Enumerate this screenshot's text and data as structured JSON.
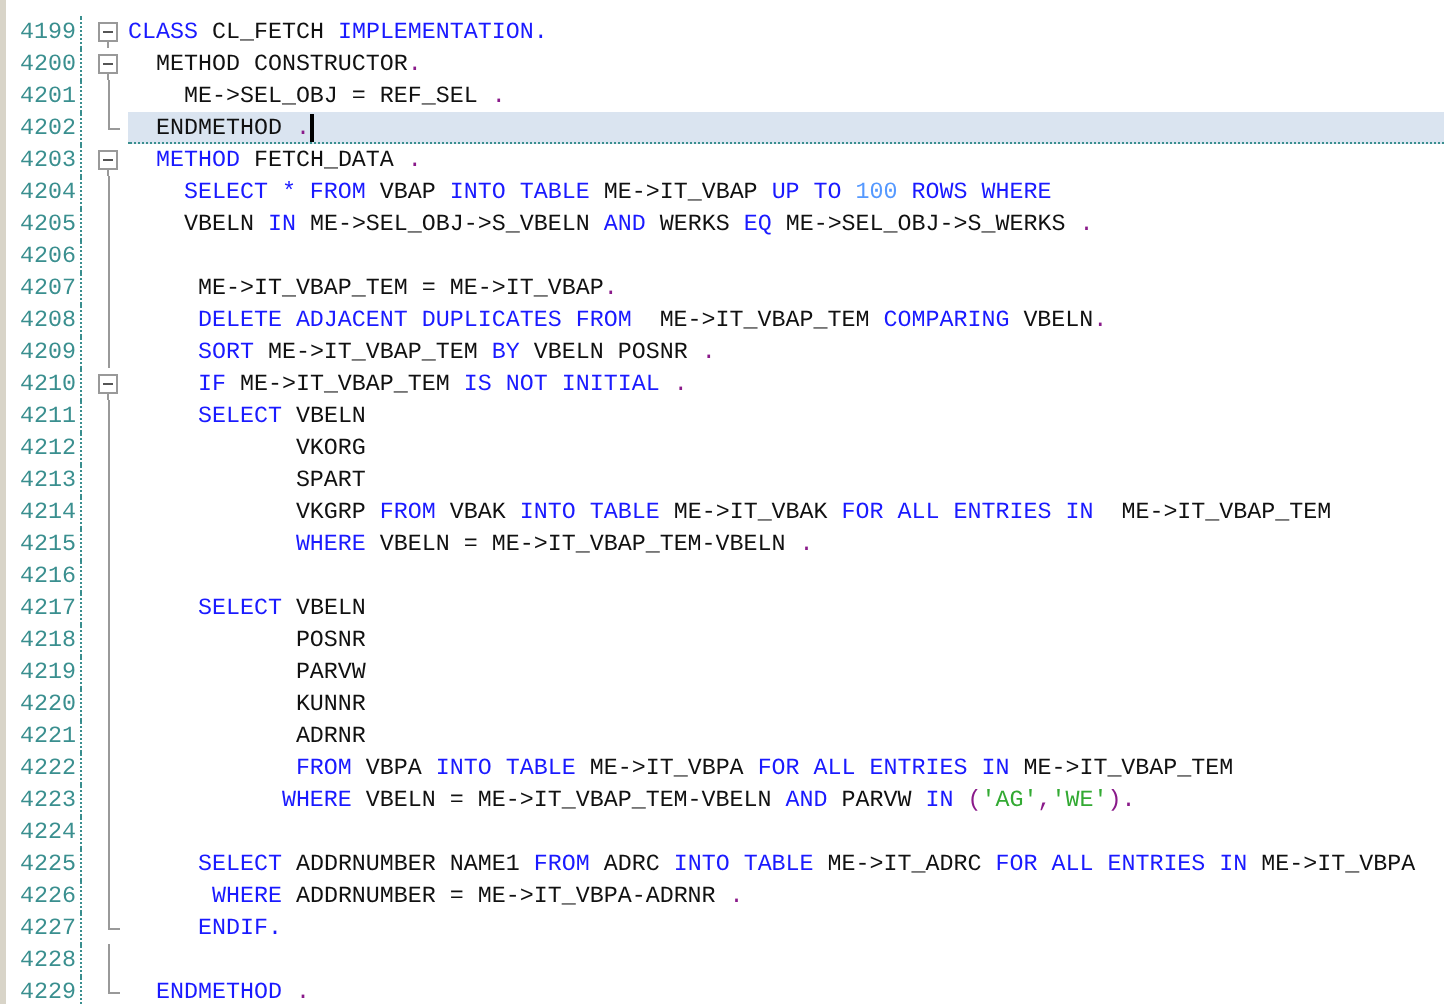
{
  "editor": {
    "lines": [
      {
        "number": "4199",
        "kind": "fold_open",
        "selected": false,
        "tokens": [
          {
            "text": "CLASS ",
            "kind": "keyword"
          },
          {
            "text": "CL_FETCH ",
            "kind": "plain"
          },
          {
            "text": "IMPLEMENTATION.",
            "kind": "keyword"
          }
        ]
      },
      {
        "number": "4200",
        "kind": "fold_open",
        "selected": false,
        "tokens": [
          {
            "text": "  METHOD CONSTRUCTOR",
            "kind": "plain"
          },
          {
            "text": ".",
            "kind": "punct"
          }
        ]
      },
      {
        "number": "4201",
        "kind": "fold_line",
        "selected": false,
        "tokens": [
          {
            "text": "    ME->SEL_OBJ = REF_SEL ",
            "kind": "plain"
          },
          {
            "text": ".",
            "kind": "punct"
          }
        ]
      },
      {
        "number": "4202",
        "kind": "fold_end",
        "selected": true,
        "tokens": [
          {
            "text": "  ENDMETHOD ",
            "kind": "plain"
          },
          {
            "text": ".",
            "kind": "punct"
          }
        ]
      },
      {
        "number": "4203",
        "kind": "fold_open",
        "selected": false,
        "tokens": [
          {
            "text": "  METHOD ",
            "kind": "keyword"
          },
          {
            "text": "FETCH_DATA ",
            "kind": "plain"
          },
          {
            "text": ".",
            "kind": "punct"
          }
        ]
      },
      {
        "number": "4204",
        "kind": "fold_line",
        "selected": false,
        "tokens": [
          {
            "text": "    SELECT * FROM ",
            "kind": "keyword"
          },
          {
            "text": "VBAP ",
            "kind": "plain"
          },
          {
            "text": "INTO TABLE ",
            "kind": "keyword"
          },
          {
            "text": "ME->IT_VBAP ",
            "kind": "plain"
          },
          {
            "text": "UP TO ",
            "kind": "keyword"
          },
          {
            "text": "100 ",
            "kind": "number"
          },
          {
            "text": "ROWS WHERE",
            "kind": "keyword"
          }
        ]
      },
      {
        "number": "4205",
        "kind": "fold_line",
        "selected": false,
        "tokens": [
          {
            "text": "    VBELN ",
            "kind": "plain"
          },
          {
            "text": "IN ",
            "kind": "keyword"
          },
          {
            "text": "ME->SEL_OBJ->S_VBELN ",
            "kind": "plain"
          },
          {
            "text": "AND ",
            "kind": "keyword"
          },
          {
            "text": "WERKS ",
            "kind": "plain"
          },
          {
            "text": "EQ ",
            "kind": "keyword"
          },
          {
            "text": "ME->SEL_OBJ->S_WERKS ",
            "kind": "plain"
          },
          {
            "text": ".",
            "kind": "punct"
          }
        ]
      },
      {
        "number": "4206",
        "kind": "fold_line",
        "selected": false
      },
      {
        "number": "4207",
        "kind": "fold_line",
        "selected": false,
        "tokens": [
          {
            "text": "     ME->IT_VBAP_TEM = ME->IT_VBAP",
            "kind": "plain"
          },
          {
            "text": ".",
            "kind": "punct"
          }
        ]
      },
      {
        "number": "4208",
        "kind": "fold_line",
        "selected": false,
        "tokens": [
          {
            "text": "     DELETE ADJACENT DUPLICATES FROM  ",
            "kind": "keyword"
          },
          {
            "text": "ME->IT_VBAP_TEM ",
            "kind": "plain"
          },
          {
            "text": "COMPARING ",
            "kind": "keyword"
          },
          {
            "text": "VBELN",
            "kind": "plain"
          },
          {
            "text": ".",
            "kind": "punct"
          }
        ]
      },
      {
        "number": "4209",
        "kind": "fold_line",
        "selected": false,
        "tokens": [
          {
            "text": "     SORT ",
            "kind": "keyword"
          },
          {
            "text": "ME->IT_VBAP_TEM ",
            "kind": "plain"
          },
          {
            "text": "BY ",
            "kind": "keyword"
          },
          {
            "text": "VBELN POSNR ",
            "kind": "plain"
          },
          {
            "text": ".",
            "kind": "punct"
          }
        ]
      },
      {
        "number": "4210",
        "kind": "fold_open",
        "selected": false,
        "tokens": [
          {
            "text": "     IF ",
            "kind": "keyword"
          },
          {
            "text": "ME->IT_VBAP_TEM ",
            "kind": "plain"
          },
          {
            "text": "IS NOT INITIAL ",
            "kind": "keyword"
          },
          {
            "text": ".",
            "kind": "punct"
          }
        ]
      },
      {
        "number": "4211",
        "kind": "fold_line",
        "selected": false,
        "tokens": [
          {
            "text": "     SELECT ",
            "kind": "keyword"
          },
          {
            "text": "VBELN",
            "kind": "plain"
          }
        ]
      },
      {
        "number": "4212",
        "kind": "fold_line",
        "selected": false,
        "tokens": [
          {
            "text": "            VKORG",
            "kind": "plain"
          }
        ]
      },
      {
        "number": "4213",
        "kind": "fold_line",
        "selected": false,
        "tokens": [
          {
            "text": "            SPART",
            "kind": "plain"
          }
        ]
      },
      {
        "number": "4214",
        "kind": "fold_line",
        "selected": false,
        "tokens": [
          {
            "text": "            VKGRP ",
            "kind": "plain"
          },
          {
            "text": "FROM ",
            "kind": "keyword"
          },
          {
            "text": "VBAK ",
            "kind": "plain"
          },
          {
            "text": "INTO TABLE ",
            "kind": "keyword"
          },
          {
            "text": "ME->IT_VBAK ",
            "kind": "plain"
          },
          {
            "text": "FOR ALL ENTRIES IN  ",
            "kind": "keyword"
          },
          {
            "text": "ME->IT_VBAP_TEM",
            "kind": "plain"
          }
        ]
      },
      {
        "number": "4215",
        "kind": "fold_line",
        "selected": false,
        "tokens": [
          {
            "text": "            WHERE ",
            "kind": "keyword"
          },
          {
            "text": "VBELN = ME->IT_VBAP_TEM-VBELN ",
            "kind": "plain"
          },
          {
            "text": ".",
            "kind": "punct"
          }
        ]
      },
      {
        "number": "4216",
        "kind": "fold_line",
        "selected": false
      },
      {
        "number": "4217",
        "kind": "fold_line",
        "selected": false,
        "tokens": [
          {
            "text": "     SELECT ",
            "kind": "keyword"
          },
          {
            "text": "VBELN",
            "kind": "plain"
          }
        ]
      },
      {
        "number": "4218",
        "kind": "fold_line",
        "selected": false,
        "tokens": [
          {
            "text": "            POSNR",
            "kind": "plain"
          }
        ]
      },
      {
        "number": "4219",
        "kind": "fold_line",
        "selected": false,
        "tokens": [
          {
            "text": "            PARVW",
            "kind": "plain"
          }
        ]
      },
      {
        "number": "4220",
        "kind": "fold_line",
        "selected": false,
        "tokens": [
          {
            "text": "            KUNNR",
            "kind": "plain"
          }
        ]
      },
      {
        "number": "4221",
        "kind": "fold_line",
        "selected": false,
        "tokens": [
          {
            "text": "            ADRNR",
            "kind": "plain"
          }
        ]
      },
      {
        "number": "4222",
        "kind": "fold_line",
        "selected": false,
        "tokens": [
          {
            "text": "            FROM ",
            "kind": "keyword"
          },
          {
            "text": "VBPA ",
            "kind": "plain"
          },
          {
            "text": "INTO TABLE ",
            "kind": "keyword"
          },
          {
            "text": "ME->IT_VBPA ",
            "kind": "plain"
          },
          {
            "text": "FOR ALL ENTRIES IN ",
            "kind": "keyword"
          },
          {
            "text": "ME->IT_VBAP_TEM",
            "kind": "plain"
          }
        ]
      },
      {
        "number": "4223",
        "kind": "fold_line",
        "selected": false,
        "tokens": [
          {
            "text": "           WHERE ",
            "kind": "keyword"
          },
          {
            "text": "VBELN = ME->IT_VBAP_TEM-VBELN ",
            "kind": "plain"
          },
          {
            "text": "AND ",
            "kind": "keyword"
          },
          {
            "text": "PARVW ",
            "kind": "plain"
          },
          {
            "text": "IN ",
            "kind": "keyword"
          },
          {
            "text": "(",
            "kind": "punct"
          },
          {
            "text": "'AG'",
            "kind": "string"
          },
          {
            "text": ",",
            "kind": "punct"
          },
          {
            "text": "'WE'",
            "kind": "string"
          },
          {
            "text": ").",
            "kind": "punct"
          }
        ]
      },
      {
        "number": "4224",
        "kind": "fold_line",
        "selected": false
      },
      {
        "number": "4225",
        "kind": "fold_line",
        "selected": false,
        "tokens": [
          {
            "text": "     SELECT ",
            "kind": "keyword"
          },
          {
            "text": "ADDRNUMBER NAME1 ",
            "kind": "plain"
          },
          {
            "text": "FROM ",
            "kind": "keyword"
          },
          {
            "text": "ADRC ",
            "kind": "plain"
          },
          {
            "text": "INTO TABLE ",
            "kind": "keyword"
          },
          {
            "text": "ME->IT_ADRC ",
            "kind": "plain"
          },
          {
            "text": "FOR ALL ENTRIES IN ",
            "kind": "keyword"
          },
          {
            "text": "ME->IT_VBPA",
            "kind": "plain"
          }
        ]
      },
      {
        "number": "4226",
        "kind": "fold_line",
        "selected": false,
        "tokens": [
          {
            "text": "      WHERE ",
            "kind": "keyword"
          },
          {
            "text": "ADDRNUMBER = ME->IT_VBPA-ADRNR ",
            "kind": "plain"
          },
          {
            "text": ".",
            "kind": "punct"
          }
        ]
      },
      {
        "number": "4227",
        "kind": "fold_end",
        "selected": false,
        "tokens": [
          {
            "text": "     ENDIF.",
            "kind": "keyword"
          }
        ]
      },
      {
        "number": "4228",
        "kind": "fold_line",
        "selected": false
      },
      {
        "number": "4229",
        "kind": "fold_end",
        "selected": false,
        "tokens": [
          {
            "text": "  ENDMETHOD ",
            "kind": "keyword"
          },
          {
            "text": ".",
            "kind": "punct"
          }
        ]
      }
    ]
  }
}
